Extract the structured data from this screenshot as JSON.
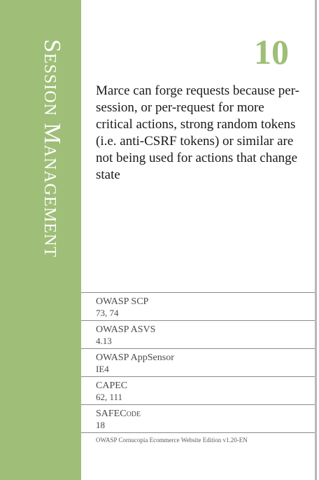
{
  "card": {
    "suit": "Session Management",
    "number": "10",
    "description": "Marce can forge requests because per-session, or per-request for more critical actions, strong random tokens (i.e. anti-CSRF tokens) or similar are not being used for actions that change state"
  },
  "references": [
    {
      "label": "OWASP SCP",
      "value": "73, 74"
    },
    {
      "label": "OWASP ASVS",
      "value": "4.13"
    },
    {
      "label": "OWASP AppSensor",
      "value": "IE4"
    },
    {
      "label": "CAPEC",
      "value": "62, 111"
    },
    {
      "label": "SAFECode",
      "value": "18"
    }
  ],
  "footer": "OWASP Cornucopia Ecommerce Website Edition v1.20-EN",
  "colors": {
    "accent": "#9fbe77",
    "text": "#1a1a1a",
    "muted": "#4a4a4a",
    "divider": "#8a8a8a"
  }
}
